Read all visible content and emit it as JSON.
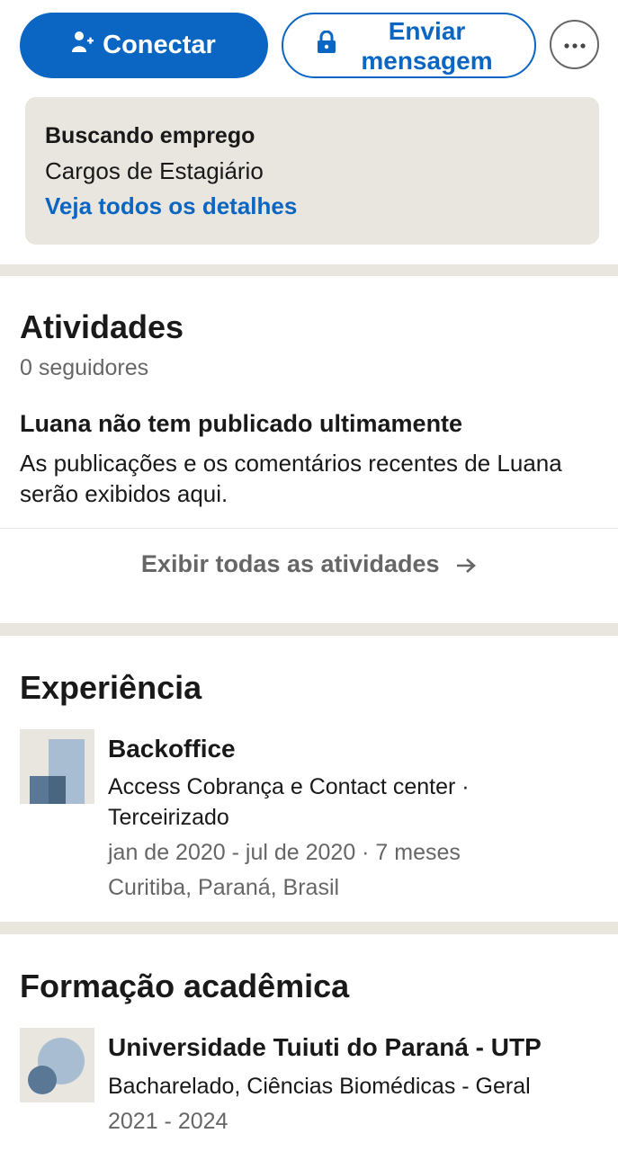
{
  "actions": {
    "connect_label": "Conectar",
    "message_label": "Enviar mensagem"
  },
  "open_to_work": {
    "title": "Buscando emprego",
    "roles": "Cargos de Estagiário",
    "details_link": "Veja todos os detalhes"
  },
  "activity": {
    "heading": "Atividades",
    "followers": "0 seguidores",
    "empty_title": "Luana não tem publicado ultimamente",
    "empty_body": "As publicações e os comentários recentes de Luana serão exibidos aqui.",
    "show_all": "Exibir todas as atividades"
  },
  "experience": {
    "heading": "Experiência",
    "items": [
      {
        "title": "Backoffice",
        "company": "Access Cobrança e Contact center · Terceirizado",
        "dates": "jan de 2020 - jul de 2020 · 7 meses",
        "location": "Curitiba, Paraná, Brasil",
        "logo_icon": "company-placeholder-icon"
      }
    ]
  },
  "education": {
    "heading": "Formação acadêmica",
    "items": [
      {
        "school": "Universidade Tuiuti do Paraná - UTP",
        "degree": "Bacharelado, Ciências Biomédicas - Geral",
        "years": "2021 - 2024",
        "logo_icon": "school-placeholder-icon"
      }
    ]
  },
  "colors": {
    "primary": "#0a66c2",
    "muted_text": "#666666",
    "card_bg": "#e9e5df"
  }
}
